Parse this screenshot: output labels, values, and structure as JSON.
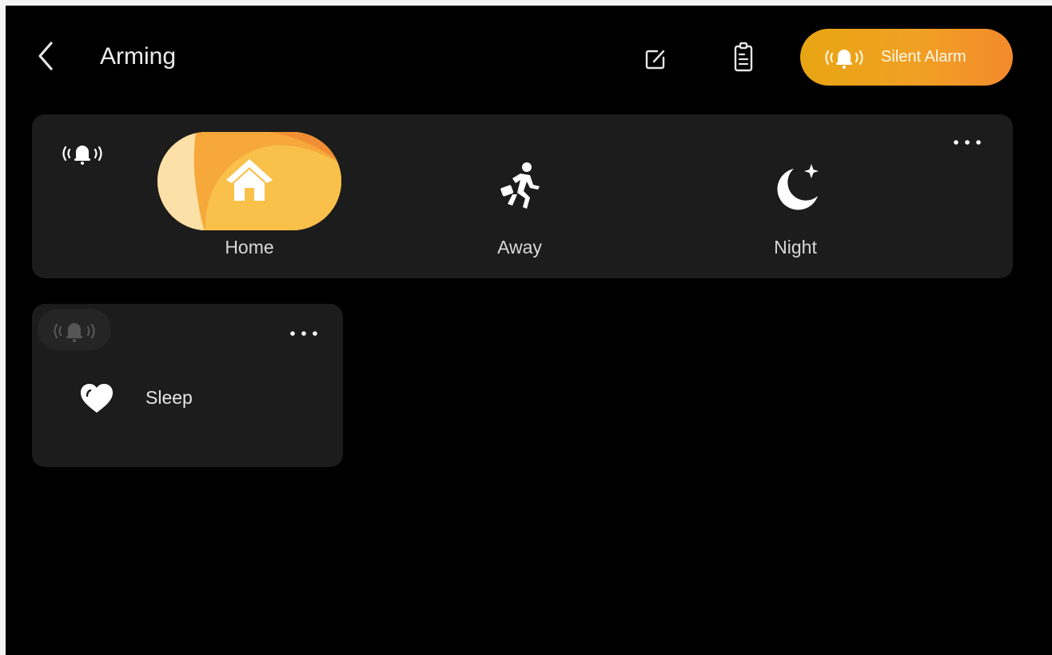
{
  "header": {
    "title": "Arming",
    "silent_alarm_label": "Silent Alarm"
  },
  "modes": [
    {
      "label": "Home",
      "icon": "home-icon",
      "selected": true
    },
    {
      "label": "Away",
      "icon": "running-person-icon",
      "selected": false
    },
    {
      "label": "Night",
      "icon": "moon-star-icon",
      "selected": false
    }
  ],
  "sleep": {
    "label": "Sleep",
    "icon": "heart-icon"
  },
  "colors": {
    "background": "#000000",
    "card": "#1c1c1c",
    "accent_start": "#e8a512",
    "accent_end": "#f38a2c",
    "text": "#ececec"
  }
}
